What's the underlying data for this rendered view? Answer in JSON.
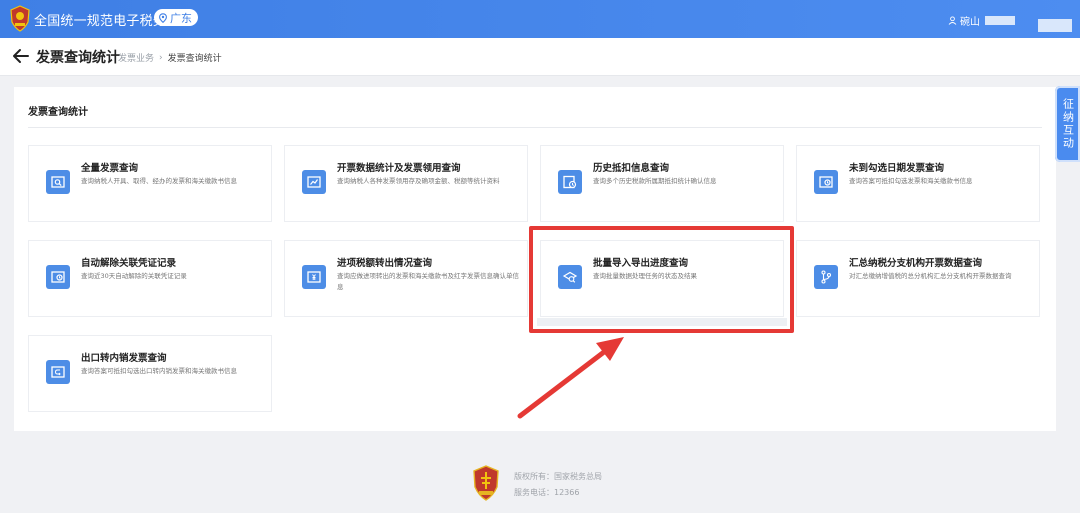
{
  "header": {
    "app_title": "全国统一规范电子税务局",
    "region": "广东",
    "user_name": "碗山"
  },
  "titlebar": {
    "page_title": "发票查询统计",
    "breadcrumb": [
      "发票业务",
      "发票查询统计"
    ]
  },
  "section_title": "发票查询统计",
  "cards": [
    {
      "title": "全量发票查询",
      "desc": "查询纳税人开具、取得、经办的发票和海关缴款书信息",
      "icon": "search-doc-icon"
    },
    {
      "title": "开票数据统计及发票领用查询",
      "desc": "查询纳税人各种发票领用存及确项金额、税额等统计资料",
      "icon": "chart-line-icon"
    },
    {
      "title": "历史抵扣信息查询",
      "desc": "查询多个历史税款所属期抵扣统计确认信息",
      "icon": "history-icon"
    },
    {
      "title": "未到勾选日期发票查询",
      "desc": "查询答案可抵扣勾选发票和海关缴款书信息",
      "icon": "clock-doc-icon"
    },
    {
      "title": "自动解除关联凭证记录",
      "desc": "查询近30天自动解除的关联凭证记录",
      "icon": "clock-doc-icon"
    },
    {
      "title": "进项税额转出情况查询",
      "desc": "查询应做进项转出的发票和海关缴款书及红字发票信息确认单信息",
      "icon": "yuan-doc-icon"
    },
    {
      "title": "批量导入导出进度查询",
      "desc": "查询批量数据处理任务的状态及结果",
      "icon": "magnifier-stack-icon"
    },
    {
      "title": "汇总纳税分支机构开票数据查询",
      "desc": "对汇总缴纳增值税的总分机构汇总分支机构开票数据查询",
      "icon": "branch-icon"
    },
    {
      "title": "出口转内销发票查询",
      "desc": "查询答案可抵扣勾选出口转内销发票和海关缴款书信息",
      "icon": "return-doc-icon"
    }
  ],
  "float_tab": "征纳互动",
  "footer": {
    "copyright": "版权所有：国家税务总局",
    "service": "服务电话：12366"
  },
  "colors": {
    "header_blue": "#4d8df0",
    "icon_blue": "#4d8de6",
    "highlight_red": "#e53935"
  }
}
